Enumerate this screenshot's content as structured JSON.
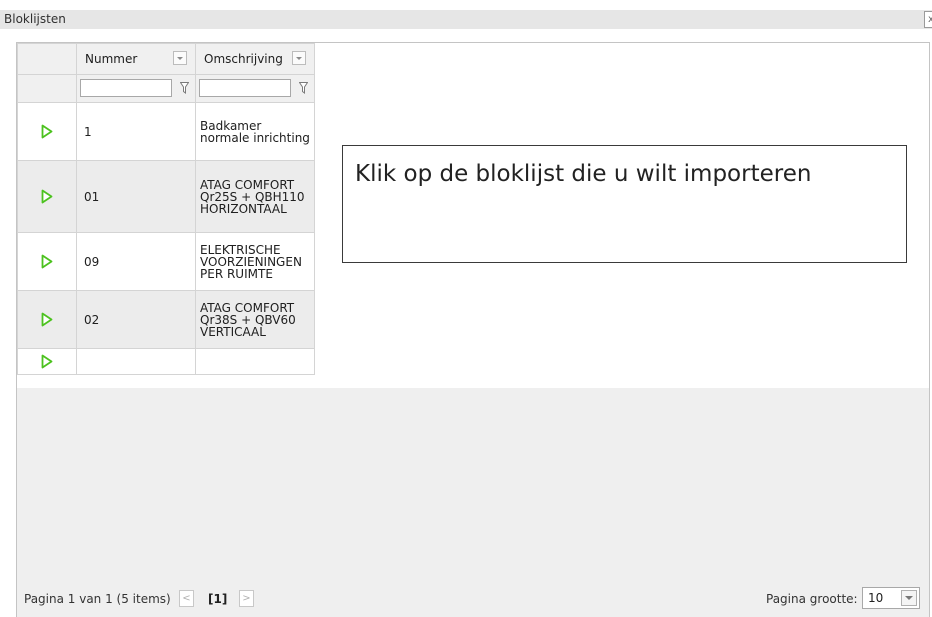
{
  "window": {
    "title": "Bloklijsten",
    "close_glyph": "x"
  },
  "grid": {
    "columns": [
      {
        "key": "action",
        "label": ""
      },
      {
        "key": "nummer",
        "label": "Nummer"
      },
      {
        "key": "omschrijving",
        "label": "Omschrijving"
      }
    ],
    "filters": {
      "nummer": "",
      "omschrijving": ""
    },
    "rows": [
      {
        "nummer": "1",
        "omschrijving": "Badkamer normale inrichting"
      },
      {
        "nummer": "01",
        "omschrijving": "ATAG COMFORT Qr25S + QBH110 HORIZONTAAL"
      },
      {
        "nummer": "09",
        "omschrijving": "ELEKTRISCHE VOORZIENINGEN PER RUIMTE"
      },
      {
        "nummer": "02",
        "omschrijving": "ATAG COMFORT Qr38S + QBV60 VERTICAAL"
      },
      {
        "nummer": "",
        "omschrijving": ""
      }
    ]
  },
  "callout": {
    "text": "Klik op de bloklijst die u wilt importeren"
  },
  "pager": {
    "info": "Pagina 1 van 1 (5 items)",
    "prev_glyph": "<",
    "current": "[1]",
    "next_glyph": ">",
    "size_label": "Pagina grootte:",
    "size_value": "10"
  },
  "icons": {
    "row_action": "play-icon",
    "filter": "filter-icon",
    "sort": "sort-dropdown-icon"
  },
  "colors": {
    "play_icon": "#4cc21f",
    "header_bg": "#f0f0f0",
    "alt_row_bg": "#ececec",
    "footer_bg": "#efefef"
  }
}
